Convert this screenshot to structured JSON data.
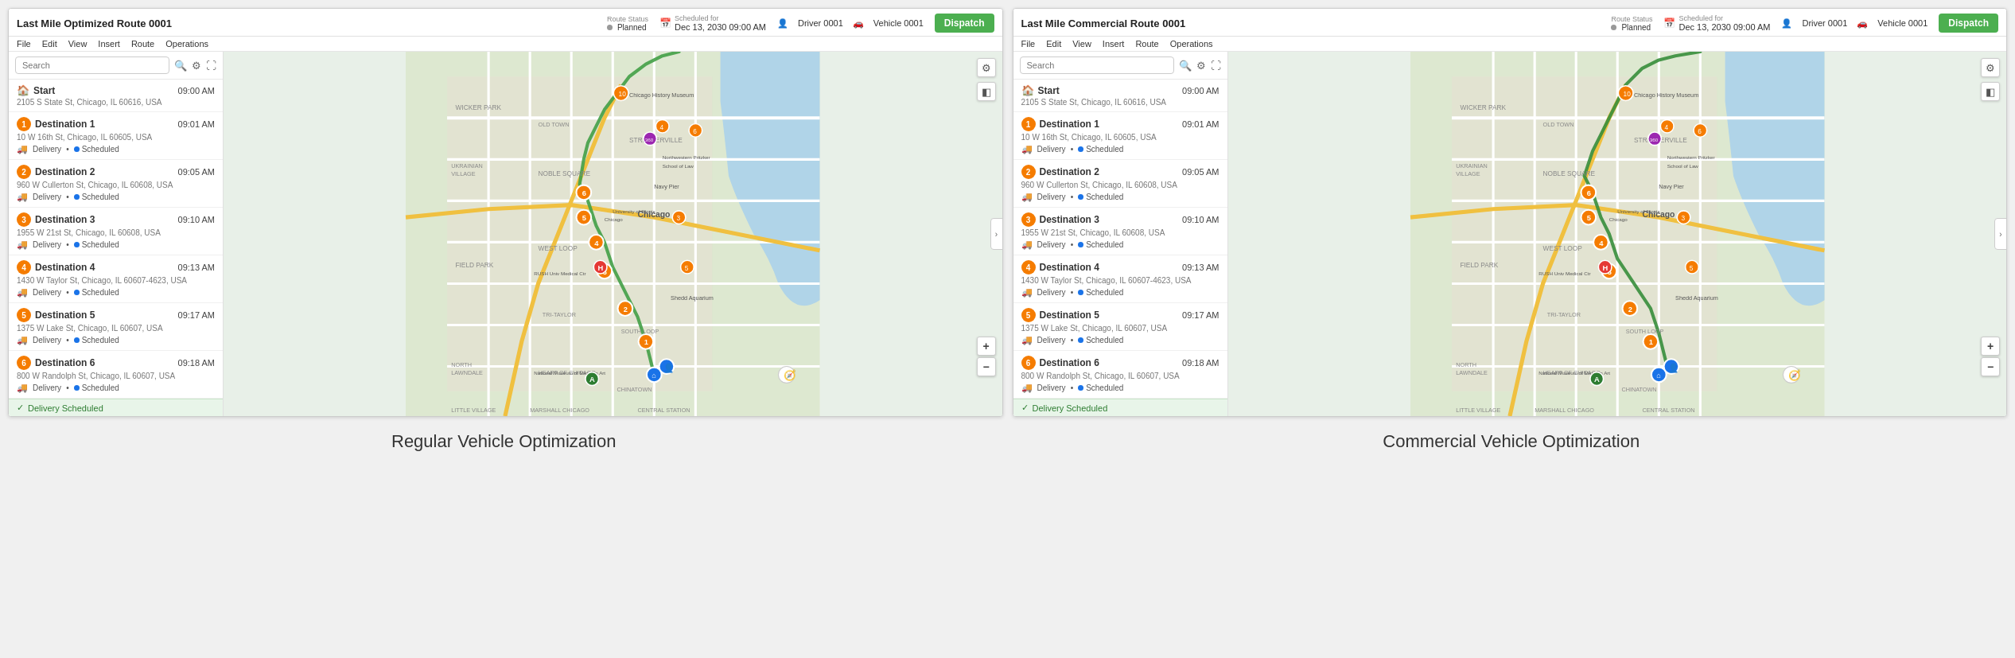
{
  "panels": [
    {
      "id": "panel-left",
      "title": "Last Mile Optimized Route 0001",
      "routeStatus": {
        "label": "Route Status",
        "value": "Planned"
      },
      "scheduledFor": {
        "label": "Scheduled for",
        "value": "Dec 13, 2030 09:00 AM"
      },
      "driver": "Driver 0001",
      "vehicle": "Vehicle 0001",
      "dispatchLabel": "Dispatch",
      "menu": [
        "File",
        "Edit",
        "View",
        "Insert",
        "Route",
        "Operations"
      ],
      "searchPlaceholder": "Search",
      "stops": [
        {
          "type": "start",
          "name": "Start",
          "time": "09:00 AM",
          "address": "2105 S State St, Chicago, IL 60616, USA"
        },
        {
          "num": 1,
          "name": "Destination 1",
          "time": "09:01 AM",
          "address": "10 W 16th St, Chicago, IL 60605, USA",
          "service": "Delivery",
          "status": "Scheduled"
        },
        {
          "num": 2,
          "name": "Destination 2",
          "time": "09:05 AM",
          "address": "960 W Cullerton St, Chicago, IL 60608, USA",
          "service": "Delivery",
          "status": "Scheduled"
        },
        {
          "num": 3,
          "name": "Destination 3",
          "time": "09:10 AM",
          "address": "1955 W 21st St, Chicago, IL 60608, USA",
          "service": "Delivery",
          "status": "Scheduled"
        },
        {
          "num": 4,
          "name": "Destination 4",
          "time": "09:13 AM",
          "address": "1430 W Taylor St, Chicago, IL 60607-4623, USA",
          "service": "Delivery",
          "status": "Scheduled"
        },
        {
          "num": 5,
          "name": "Destination 5",
          "time": "09:17 AM",
          "address": "1375 W Lake St, Chicago, IL 60607, USA",
          "service": "Delivery",
          "status": "Scheduled"
        },
        {
          "num": 6,
          "name": "Destination 6",
          "time": "09:18 AM",
          "address": "800 W Randolph St, Chicago, IL 60607, USA",
          "service": "Delivery",
          "status": "Scheduled"
        }
      ],
      "deliveryBanner": "Delivery Scheduled",
      "caption": "Regular Vehicle Optimization"
    },
    {
      "id": "panel-right",
      "title": "Last Mile Commercial Route 0001",
      "routeStatus": {
        "label": "Route Status",
        "value": "Planned"
      },
      "scheduledFor": {
        "label": "Scheduled for",
        "value": "Dec 13, 2030 09:00 AM"
      },
      "driver": "Driver 0001",
      "vehicle": "Vehicle 0001",
      "dispatchLabel": "Dispatch",
      "menu": [
        "File",
        "Edit",
        "View",
        "Insert",
        "Route",
        "Operations"
      ],
      "searchPlaceholder": "Search",
      "stops": [
        {
          "type": "start",
          "name": "Start",
          "time": "09:00 AM",
          "address": "2105 S State St, Chicago, IL 60616, USA"
        },
        {
          "num": 1,
          "name": "Destination 1",
          "time": "09:01 AM",
          "address": "10 W 16th St, Chicago, IL 60605, USA",
          "service": "Delivery",
          "status": "Scheduled"
        },
        {
          "num": 2,
          "name": "Destination 2",
          "time": "09:05 AM",
          "address": "960 W Cullerton St, Chicago, IL 60608, USA",
          "service": "Delivery",
          "status": "Scheduled"
        },
        {
          "num": 3,
          "name": "Destination 3",
          "time": "09:10 AM",
          "address": "1955 W 21st St, Chicago, IL 60608, USA",
          "service": "Delivery",
          "status": "Scheduled"
        },
        {
          "num": 4,
          "name": "Destination 4",
          "time": "09:13 AM",
          "address": "1430 W Taylor St, Chicago, IL 60607-4623, USA",
          "service": "Delivery",
          "status": "Scheduled"
        },
        {
          "num": 5,
          "name": "Destination 5",
          "time": "09:17 AM",
          "address": "1375 W Lake St, Chicago, IL 60607, USA",
          "service": "Delivery",
          "status": "Scheduled"
        },
        {
          "num": 6,
          "name": "Destination 6",
          "time": "09:18 AM",
          "address": "800 W Randolph St, Chicago, IL 60607, USA",
          "service": "Delivery",
          "status": "Scheduled"
        }
      ],
      "deliveryBanner": "Delivery Scheduled",
      "caption": "Commercial Vehicle Optimization"
    }
  ],
  "icons": {
    "search": "🔍",
    "filter": "⚙",
    "expand": "⛶",
    "settings": "⚙",
    "layers": "◧",
    "zoom_in": "+",
    "zoom_out": "−",
    "collapse": "›",
    "home": "🏠",
    "truck": "🚚",
    "person": "👤",
    "calendar": "📅",
    "vehicle": "🚗",
    "chevron": "❯"
  }
}
